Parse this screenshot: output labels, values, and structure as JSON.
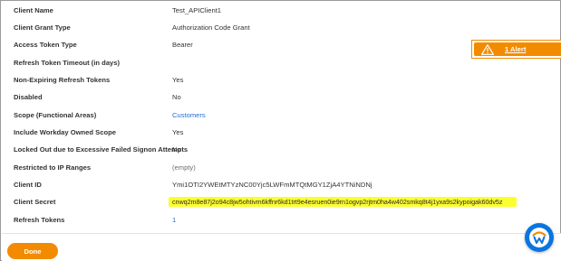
{
  "fields": [
    {
      "label": "Client Name",
      "value": "Test_APIClient1"
    },
    {
      "label": "Client Grant Type",
      "value": "Authorization Code Grant"
    },
    {
      "label": "Access Token Type",
      "value": "Bearer"
    },
    {
      "label": "Refresh Token Timeout (in days)",
      "value": ""
    },
    {
      "label": "Non-Expiring Refresh Tokens",
      "value": "Yes"
    },
    {
      "label": "Disabled",
      "value": "No"
    },
    {
      "label": "Scope (Functional Areas)",
      "value": "Customers"
    },
    {
      "label": "Include Workday Owned Scope",
      "value": "Yes"
    },
    {
      "label": "Locked Out due to Excessive Failed Signon Attempts",
      "value": "No"
    },
    {
      "label": "Restricted to IP Ranges",
      "value": "(empty)"
    },
    {
      "label": "Client ID",
      "value": "Ymi1OTI2YWEtMTYzNC00Yjc5LWFmMTQtMGY1ZjA4YTNiNDNj"
    },
    {
      "label": "Client Secret",
      "value": "cnwq2m8e87j2o94c8jw5ohtivm6kffnr6kd1trt9e4esruen0ie9rn1ogvp2rjtm0ha4w402smkq8t4j1yxa9s2kypoigak60dv5z"
    },
    {
      "label": "Refresh Tokens",
      "value": "1"
    }
  ],
  "alert": {
    "label": "1 Alert",
    "icon": "warning-triangle-icon",
    "color": "#f38b00"
  },
  "footer": {
    "done_label": "Done"
  },
  "colors": {
    "accent": "#f38b00",
    "link": "#1f6fd6",
    "highlight": "#fbff2e",
    "brand_blue": "#0875e1"
  }
}
